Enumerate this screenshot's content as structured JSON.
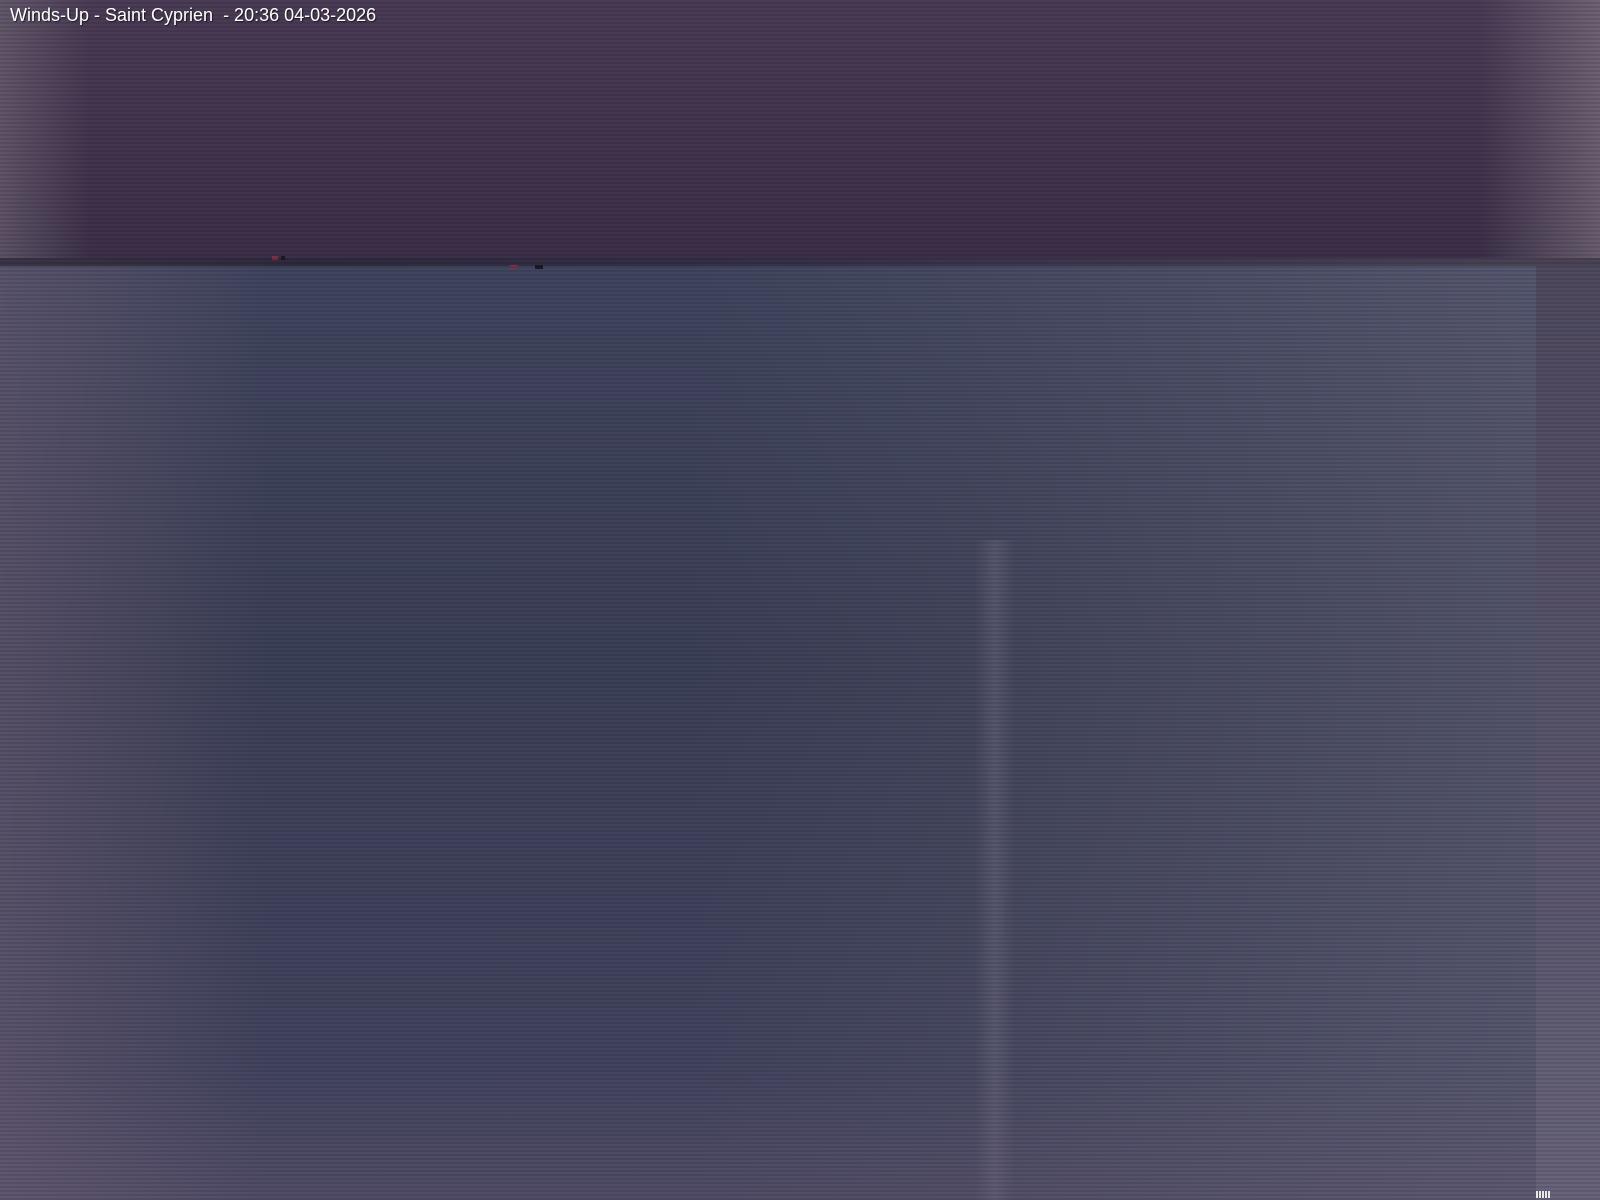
{
  "overlay": {
    "caption": "Winds-Up - Saint Cyprien  - 20:36 04-03-2026"
  },
  "scene": {
    "description_colors": {
      "sky": "#43354f",
      "water": "#3c4058",
      "horizon": "#2f2a3d"
    }
  }
}
